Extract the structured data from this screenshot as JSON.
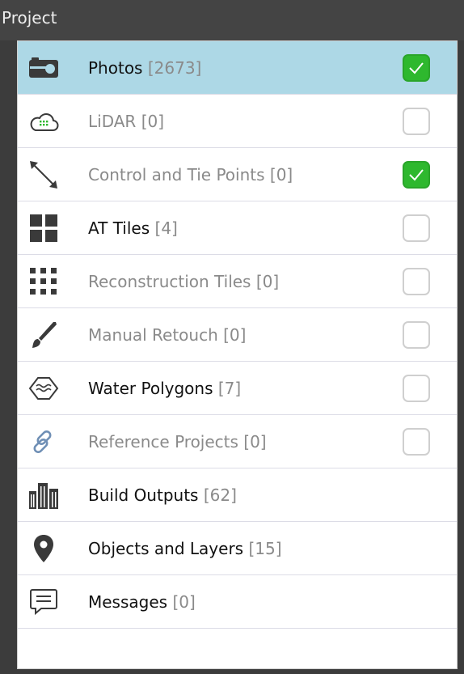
{
  "panel": {
    "title": "Project"
  },
  "items": [
    {
      "name": "Photos",
      "count": "[2673]",
      "icon": "camera-icon",
      "active": true,
      "selected": true,
      "has_checkbox": true,
      "checked": true
    },
    {
      "name": "LiDAR",
      "count": "[0]",
      "icon": "cloud-icon",
      "active": false,
      "selected": false,
      "has_checkbox": true,
      "checked": false
    },
    {
      "name": "Control and Tie Points",
      "count": "[0]",
      "icon": "diagonal-arrows-icon",
      "active": false,
      "selected": false,
      "has_checkbox": true,
      "checked": true
    },
    {
      "name": "AT Tiles",
      "count": "[4]",
      "icon": "tiles-grid-icon",
      "active": true,
      "selected": false,
      "has_checkbox": true,
      "checked": false
    },
    {
      "name": "Reconstruction Tiles",
      "count": "[0]",
      "icon": "dot-grid-icon",
      "active": false,
      "selected": false,
      "has_checkbox": true,
      "checked": false
    },
    {
      "name": "Manual Retouch",
      "count": "[0]",
      "icon": "brush-icon",
      "active": false,
      "selected": false,
      "has_checkbox": true,
      "checked": false
    },
    {
      "name": "Water Polygons",
      "count": "[7]",
      "icon": "water-polygon-icon",
      "active": true,
      "selected": false,
      "has_checkbox": true,
      "checked": false
    },
    {
      "name": "Reference Projects",
      "count": "[0]",
      "icon": "link-icon",
      "active": false,
      "selected": false,
      "has_checkbox": true,
      "checked": false
    },
    {
      "name": "Build Outputs",
      "count": "[62]",
      "icon": "buildings-icon",
      "active": true,
      "selected": false,
      "has_checkbox": false,
      "checked": false
    },
    {
      "name": "Objects and Layers",
      "count": "[15]",
      "icon": "map-pin-icon",
      "active": true,
      "selected": false,
      "has_checkbox": false,
      "checked": false
    },
    {
      "name": "Messages",
      "count": "[0]",
      "icon": "message-icon",
      "active": true,
      "selected": false,
      "has_checkbox": false,
      "checked": false
    }
  ],
  "colors": {
    "selected_row": "#add8e6",
    "check_green": "#2eb82e",
    "active_text": "#111111",
    "inactive_text": "#8a8a8a",
    "icon_dark": "#3a3a3a",
    "icon_light": "#8a8a8a",
    "link_icon": "#6f8fb5"
  }
}
